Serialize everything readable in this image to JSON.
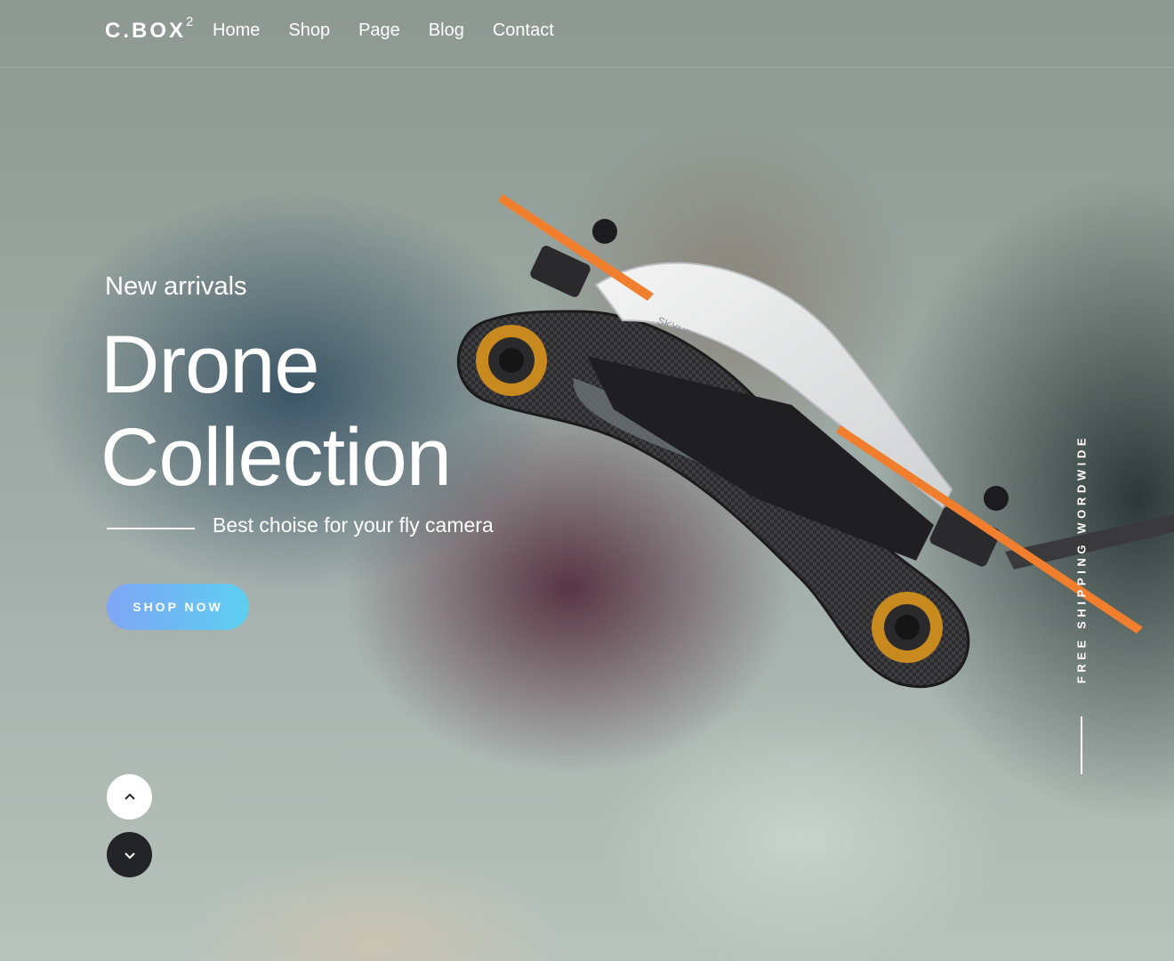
{
  "nav": {
    "logo": "C.BOX",
    "logo_sup": "2",
    "items": [
      "Home",
      "Shop",
      "Page",
      "Blog",
      "Contact"
    ]
  },
  "hero": {
    "eyebrow": "New arrivals",
    "title_line1": "Drone",
    "title_line2": "Collection",
    "tagline": "Best choise for your fly camera",
    "cta": "SHOP NOW",
    "side_text": "FREE SHIPPING WORDWIDE",
    "drone_brand": "SKYHERO"
  },
  "icons": {
    "up": "chevron-up-icon",
    "down": "chevron-down-icon"
  },
  "colors": {
    "cta_start": "#7fa6f5",
    "cta_end": "#5ccff0",
    "dark_button": "#232427",
    "propeller": "#f07e2c"
  }
}
